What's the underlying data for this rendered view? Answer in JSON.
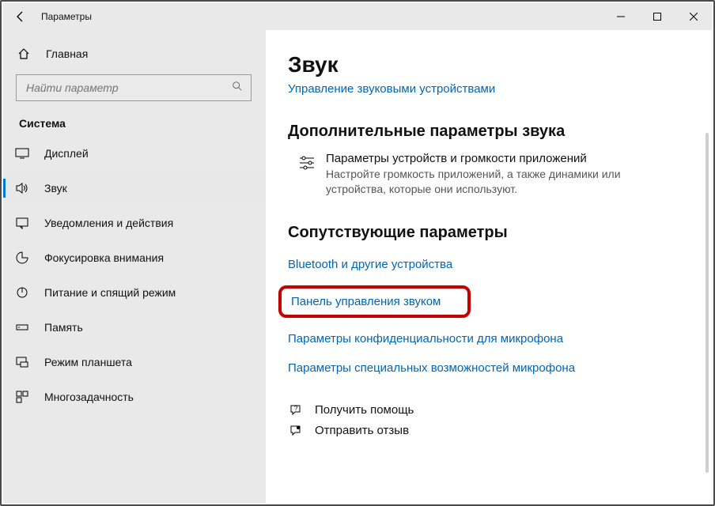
{
  "window": {
    "title": "Параметры"
  },
  "sidebar": {
    "home": "Главная",
    "search_placeholder": "Найти параметр",
    "section": "Система",
    "items": [
      {
        "label": "Дисплей"
      },
      {
        "label": "Звук"
      },
      {
        "label": "Уведомления и действия"
      },
      {
        "label": "Фокусировка внимания"
      },
      {
        "label": "Питание и спящий режим"
      },
      {
        "label": "Память"
      },
      {
        "label": "Режим планшета"
      },
      {
        "label": "Многозадачность"
      }
    ]
  },
  "content": {
    "title": "Звук",
    "subtitle": "Управление звуковыми устройствами",
    "section1": "Дополнительные параметры звука",
    "volume_title": "Параметры устройств и громкости приложений",
    "volume_desc": "Настройте громкость приложений, а также динамики или устройства, которые они используют.",
    "section2": "Сопутствующие параметры",
    "link_bluetooth": "Bluetooth и другие устройства",
    "link_sound_panel": "Панель управления звуком",
    "link_mic_privacy": "Параметры конфиденциальности для микрофона",
    "link_mic_access": "Параметры специальных возможностей микрофона",
    "help": "Получить помощь",
    "feedback": "Отправить отзыв"
  }
}
